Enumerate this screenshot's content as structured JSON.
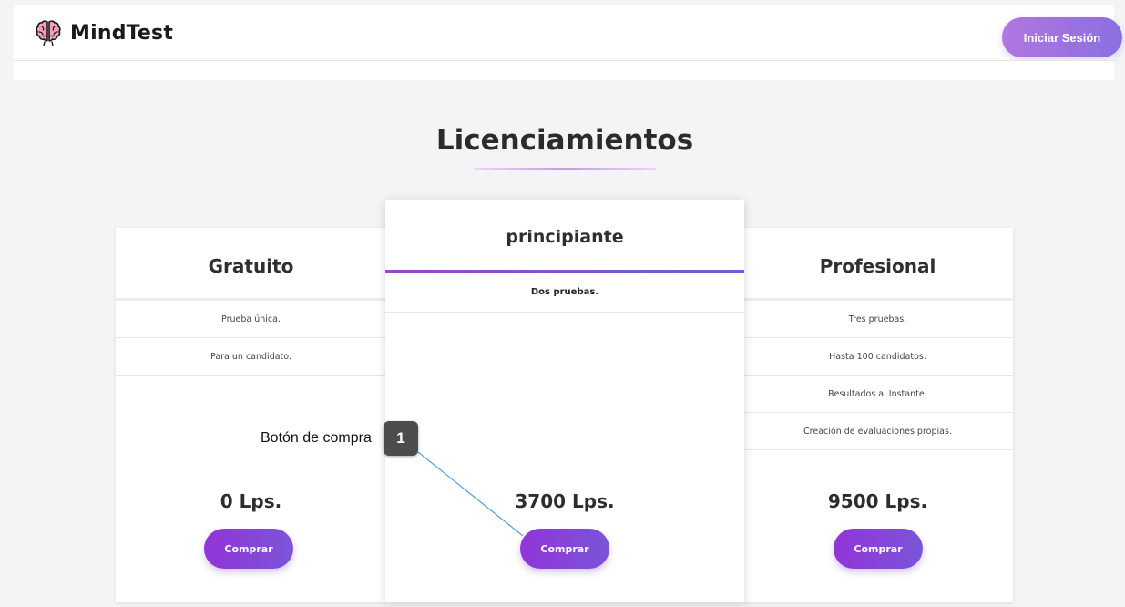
{
  "header": {
    "brand": "MindTest",
    "login_label": "Iniciar Sesión"
  },
  "page": {
    "title": "Licenciamientos"
  },
  "plans": [
    {
      "name": "Gratuito",
      "features": [
        "Prueba única.",
        "Para un candidato."
      ],
      "price": "0 Lps.",
      "button": "Comprar"
    },
    {
      "name": "principiante",
      "features": [
        "Dos pruebas."
      ],
      "price": "3700 Lps.",
      "button": "Comprar"
    },
    {
      "name": "Profesional",
      "features": [
        "Tres pruebas.",
        "Hasta 100 candidatos.",
        "Resultados al Instante.",
        "Creación de evaluaciones propias."
      ],
      "price": "9500 Lps.",
      "button": "Comprar"
    }
  ],
  "annotation": {
    "label": "Botón de compra",
    "number": "1"
  },
  "colors": {
    "accent_purple": "#9234d8",
    "accent_violet": "#7a55d9",
    "login_gradient_start": "#b176e0",
    "annotation_line": "#5aa0d8"
  },
  "icons": {
    "logo": "brain-icon"
  }
}
